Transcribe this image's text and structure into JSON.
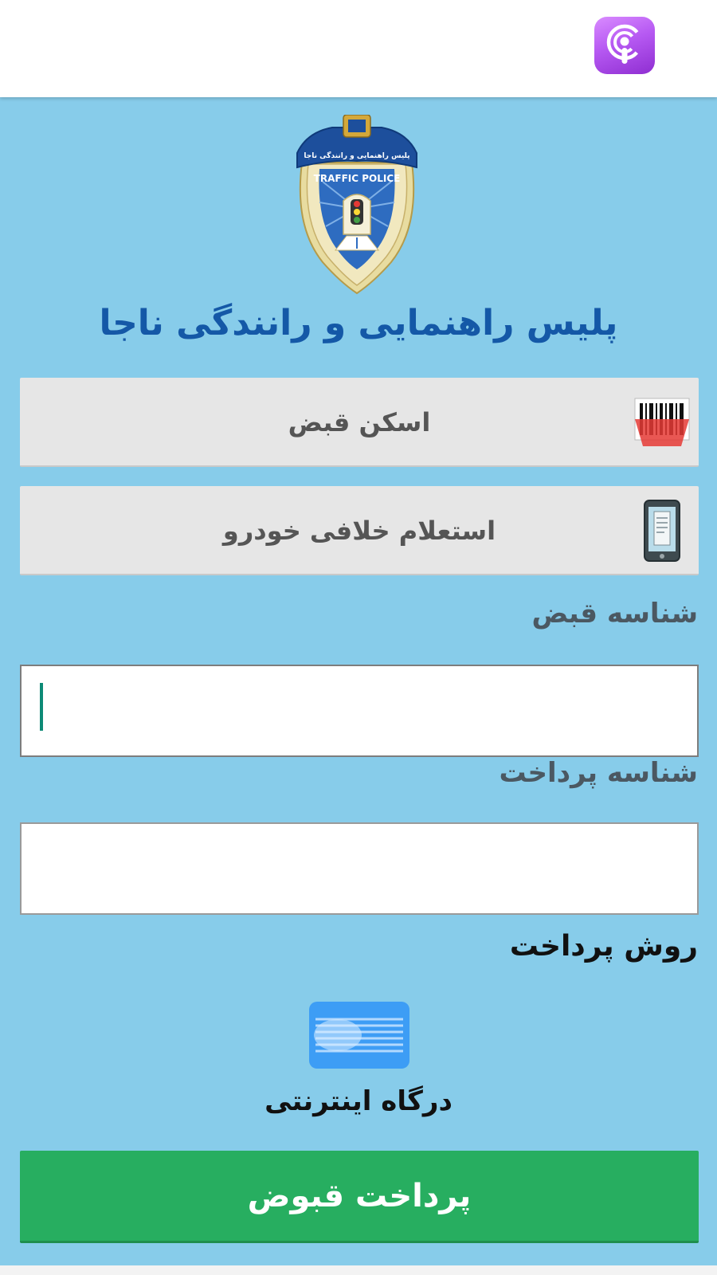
{
  "app_bar": {
    "app_icon": "podcast-icon",
    "icon_color": "#b659f2"
  },
  "header": {
    "emblem": "traffic-police-emblem",
    "emblem_text_top": "پلیس راهنمایی و رانندگی ناجا",
    "emblem_text_en": "TRAFFIC POLICE",
    "title": "پلیس راهنمایی و رانندگی ناجا",
    "title_color": "#1458a7"
  },
  "menu": {
    "scan": {
      "label": "اسکن قبض",
      "icon": "barcode-scan-icon"
    },
    "inquiry": {
      "label": "استعلام خلافی خودرو",
      "icon": "mobile-receipt-icon"
    }
  },
  "form": {
    "bill_id": {
      "label": "شناسه قبض",
      "value": "",
      "placeholder": ""
    },
    "payment_id": {
      "label": "شناسه پرداخت",
      "value": "",
      "placeholder": ""
    }
  },
  "payment_method": {
    "label": "روش پرداخت",
    "option": {
      "label": "درگاه اینترنتی",
      "icon": "bank-card-icon"
    }
  },
  "pay_button": {
    "label": "پرداخت قبوض",
    "color": "#27ae60"
  },
  "colors": {
    "background": "#87ccea",
    "menu_button": "#e6e6e6",
    "field_label": "#4b5862",
    "caret": "#0d8a76"
  }
}
